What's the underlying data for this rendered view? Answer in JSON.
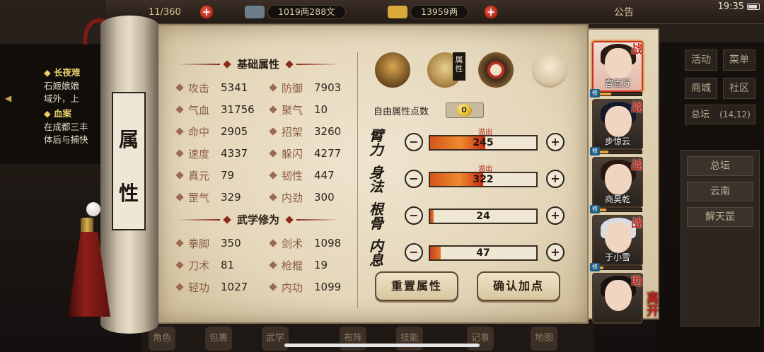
{
  "top_bar": {
    "stamina": "11/360",
    "copper": "1019两288文",
    "silver": "13959两",
    "notice": "公告",
    "clock": "19:35"
  },
  "quest_panel": {
    "lines": [
      {
        "text": "◆ 长夜难",
        "kind": "title"
      },
      {
        "text": "石姬娘娘",
        "kind": "body"
      },
      {
        "text": "域外，上",
        "kind": "body"
      },
      {
        "text": "◆ 血案",
        "kind": "title"
      },
      {
        "text": "在成都三丰",
        "kind": "body"
      },
      {
        "text": "体后与捕快",
        "kind": "body"
      }
    ]
  },
  "scroll_title": [
    "属",
    "性"
  ],
  "base_section": {
    "title": "基础属性",
    "stats": [
      {
        "label": "攻击",
        "value": "5341"
      },
      {
        "label": "防御",
        "value": "7903"
      },
      {
        "label": "气血",
        "value": "31756"
      },
      {
        "label": "聚气",
        "value": "10"
      },
      {
        "label": "命中",
        "value": "2905"
      },
      {
        "label": "招架",
        "value": "3260"
      },
      {
        "label": "速度",
        "value": "4337"
      },
      {
        "label": "躲闪",
        "value": "4277"
      },
      {
        "label": "真元",
        "value": "79"
      },
      {
        "label": "韧性",
        "value": "447"
      },
      {
        "label": "罡气",
        "value": "329"
      },
      {
        "label": "内劲",
        "value": "300"
      }
    ]
  },
  "martial_section": {
    "title": "武学修为",
    "stats": [
      {
        "label": "拳脚",
        "value": "350"
      },
      {
        "label": "剑术",
        "value": "1098"
      },
      {
        "label": "刀术",
        "value": "81"
      },
      {
        "label": "枪棍",
        "value": "19"
      },
      {
        "label": "轻功",
        "value": "1027"
      },
      {
        "label": "内功",
        "value": "1099"
      }
    ]
  },
  "tabs": {
    "active_label": "属性",
    "items": [
      "hat-icon",
      "scroll-icon",
      "bagua-icon",
      "meridian-body-icon"
    ]
  },
  "free_points": {
    "label": "自由属性点数",
    "value": "0"
  },
  "attributes": [
    {
      "name": "臂力",
      "value": "245",
      "fill": 0.52,
      "overflow": "溢出",
      "hot": true
    },
    {
      "name": "身法",
      "value": "322",
      "fill": 0.5,
      "overflow": "溢出",
      "hot": true
    },
    {
      "name": "根骨",
      "value": "24",
      "fill": 0.03,
      "overflow": "",
      "hot": false
    },
    {
      "name": "内息",
      "value": "47",
      "fill": 0.1,
      "overflow": "",
      "hot": false
    }
  ],
  "buttons": {
    "reset": "重置属性",
    "confirm": "确认加点",
    "minus": "−",
    "plus": "+"
  },
  "party": [
    {
      "name": "宫百万",
      "badge": "战",
      "selected": true,
      "hair": "#2a1a14"
    },
    {
      "name": "步惊云",
      "badge": "战",
      "selected": false,
      "hair": "#15182a"
    },
    {
      "name": "商昊乾",
      "badge": "战",
      "selected": false,
      "hair": "#2a1510"
    },
    {
      "name": "于小雪",
      "badge": "战",
      "selected": false,
      "hair": "#d8dde5"
    },
    {
      "name": "",
      "badge": "助",
      "selected": false,
      "hair": "#1a1210"
    }
  ],
  "cultivation_badge": "修",
  "leave_label": "离开",
  "right_menu": {
    "grid": [
      "活动",
      "菜单",
      "商城",
      "社区"
    ],
    "location": "总坛",
    "coords": "(14,12)",
    "list": [
      "总坛",
      "云南",
      "解天罡"
    ]
  },
  "bottom_bar": [
    "角色",
    "包裹",
    "武学",
    "布阵",
    "技能",
    "记事",
    "地图"
  ],
  "colors": {
    "accent_red": "#c2261a",
    "bar_orange": "#e67a2c",
    "paper": "#e4d6b9"
  }
}
